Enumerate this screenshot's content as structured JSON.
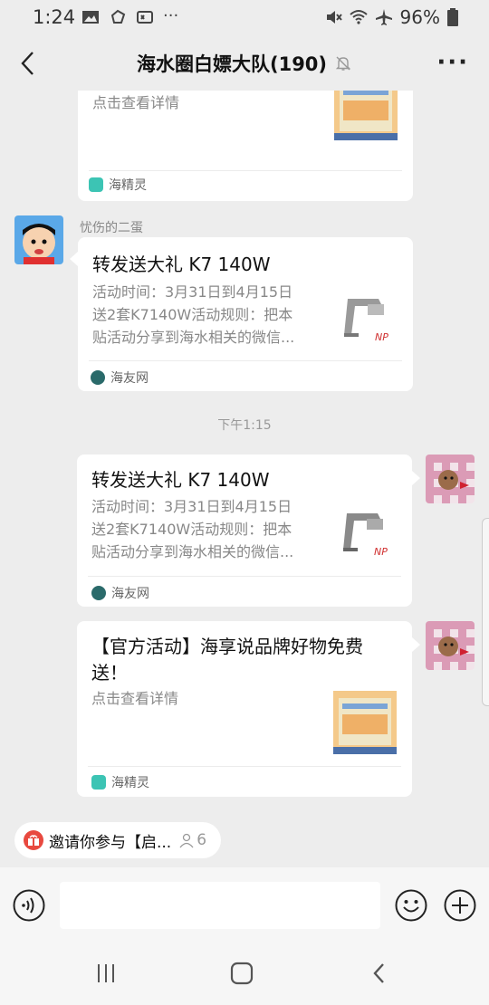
{
  "status_bar": {
    "time": "1:24",
    "battery": "96%"
  },
  "nav": {
    "title": "海水圈白嫖大队(190)",
    "more": "···"
  },
  "messages": [
    {
      "desc": "点击查看详情",
      "source": "海精灵"
    },
    {
      "sender": "忧伤的二蛋",
      "title": "转发送大礼 K7 140W",
      "desc_lines": [
        "活动时间：3月31日到4月15日",
        "送2套K7140W活动规则：把本",
        "贴活动分享到海水相关的微信..."
      ],
      "source": "海友网"
    },
    {
      "time": "下午1:15"
    },
    {
      "title": "转发送大礼 K7 140W",
      "desc_lines": [
        "活动时间：3月31日到4月15日",
        "送2套K7140W活动规则：把本",
        "贴活动分享到海水相关的微信..."
      ],
      "source": "海友网"
    },
    {
      "title_lines": [
        "【官方活动】海享说品牌好物免费",
        "送！"
      ],
      "desc": "点击查看详情",
      "source": "海精灵"
    }
  ],
  "invite": {
    "text": "邀请你参与【启...",
    "count": "6"
  },
  "colors": {
    "background": "#ededed",
    "card": "#ffffff",
    "invite_icon": "#e8493f",
    "source_haijingling": "#3cc4b4",
    "source_haiyouwang": "#2a6a6a"
  }
}
